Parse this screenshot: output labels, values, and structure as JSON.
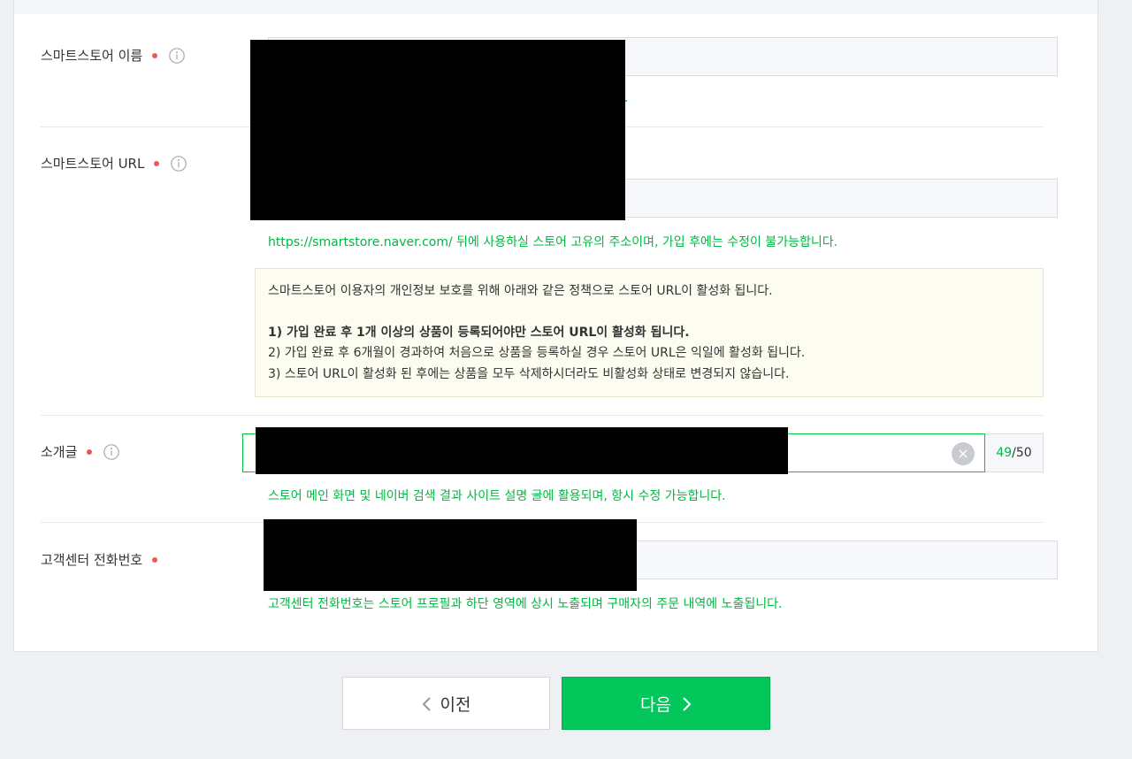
{
  "fields": {
    "store_name": {
      "label": "스마트스토어 이름"
    },
    "store_url": {
      "label": "스마트스토어 URL",
      "help": "https://smartstore.naver.com/ 뒤에 사용하실 스토어 고유의 주소이며, 가입 후에는 수정이 불가능합니다.",
      "notice": {
        "intro": "스마트스토어 이용자의 개인정보 보호를 위해 아래와 같은 정책으로 스토어 URL이 활성화 됩니다.",
        "items": [
          "1) 가입 완료 후 1개 이상의 상품이 등록되어야만 스토어 URL이 활성화 됩니다.",
          "2) 가입 완료 후 6개월이 경과하여 처음으로 상품을 등록하실 경우 스토어 URL은 익일에 활성화 됩니다.",
          "3) 스토어 URL이 활성화 된 후에는 상품을 모두 삭제하시더라도 비활성화 상태로 변경되지 않습니다."
        ]
      }
    },
    "introduction": {
      "label": "소개글",
      "help": "스토어 메인 화면 및 네이버 검색 결과 사이트 설명 글에 활용되며, 항시 수정 가능합니다.",
      "count_current": "49",
      "count_max": "/50"
    },
    "cs_phone": {
      "label": "고객센터 전화번호",
      "help": "고객센터 전화번호는 스토어 프로필과 하단 영역에 상시 노출되며 구매자의 주문 내역에 노출됩니다."
    }
  },
  "buttons": {
    "prev": "이전",
    "next": "다음"
  },
  "colors": {
    "accent_green": "#00b843",
    "button_green": "#03c75a",
    "required_dot": "#f05650"
  }
}
